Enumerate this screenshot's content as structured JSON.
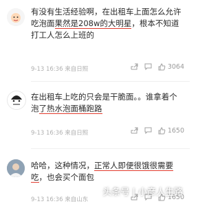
{
  "comments": [
    {
      "text_before": "有没有生活经验啊，在出租车上面怎么允许吃泡面",
      "highlight": "果然是208w的大明星",
      "text_after": "，根本不知道打工人怎么上班的",
      "meta": "9-13 16:36 来自日照",
      "actions": {
        "share": "",
        "comment": "",
        "likes": "3064"
      }
    },
    {
      "text_before": "在出租车上吃的只会是干脆面。。谁拿着个泡",
      "highlight": "了热水泡面桶跑路",
      "text_after": "",
      "meta": "9-13 16:36 来自日照",
      "actions": {
        "share": "",
        "comment": "",
        "likes": "1650"
      }
    },
    {
      "text_before": "哈哈，这种情况，",
      "highlight": "正常人即便很饿很需要吃",
      "text_after": "，也会买个面包",
      "meta": "9-13 16:36 来自山东",
      "actions": {
        "share": "",
        "comment": "",
        "likes": "1650"
      }
    }
  ],
  "watermark": "头条号 | 小彦人生路"
}
